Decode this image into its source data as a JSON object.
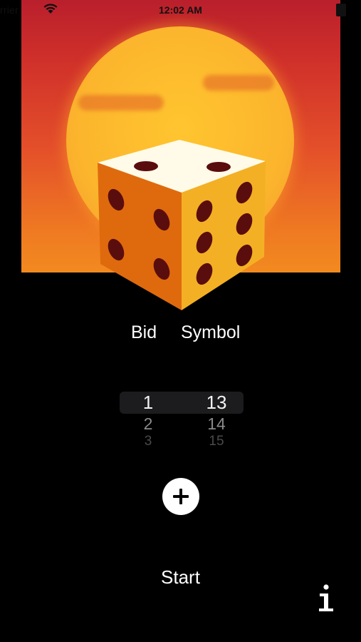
{
  "status_bar": {
    "carrier": "rrier",
    "time": "12:02 AM",
    "icons": [
      "wifi-icon",
      "battery-icon"
    ]
  },
  "hero": {
    "image": "dice-sunset-illustration",
    "colors": {
      "sky_top": "#b91f2c",
      "sky_bottom": "#f28a1f",
      "sun": "#fcb52d",
      "die_top": "#fffbe8",
      "die_left": "#df6a0e",
      "die_right": "#f3b024",
      "pips": "#5a0d0d"
    }
  },
  "labels": {
    "bid": "Bid",
    "symbol": "Symbol"
  },
  "picker": {
    "bid_values": [
      "1",
      "2",
      "3"
    ],
    "symbol_values": [
      "13",
      "14",
      "15"
    ],
    "selected_bid": "1",
    "selected_symbol": "13"
  },
  "actions": {
    "add_icon": "plus-circle-icon",
    "start_label": "Start",
    "info_icon": "info-icon"
  }
}
